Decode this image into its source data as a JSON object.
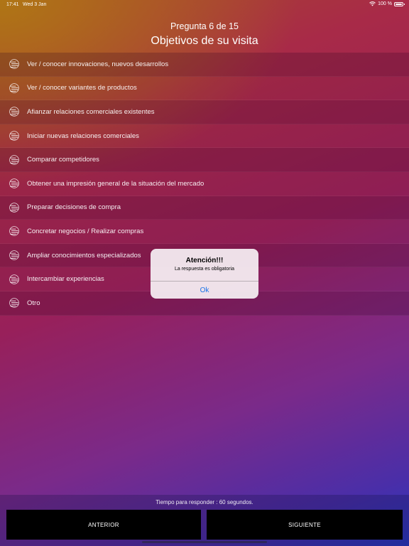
{
  "status_bar": {
    "time": "17:41",
    "date": "Wed 3 Jan",
    "battery": "100 %"
  },
  "header": {
    "counter": "Pregunta 6 de 15",
    "title": "Objetivos de su visita"
  },
  "options": [
    {
      "label": "Ver / conocer innovaciones, nuevos desarrollos"
    },
    {
      "label": "Ver / conocer variantes de productos"
    },
    {
      "label": "Afianzar relaciones comerciales existentes"
    },
    {
      "label": "Iniciar nuevas relaciones comerciales"
    },
    {
      "label": "Comparar competidores"
    },
    {
      "label": "Obtener una impresión general de la situación del mercado"
    },
    {
      "label": "Preparar decisiones de compra"
    },
    {
      "label": "Concretar negocios / Realizar compras"
    },
    {
      "label": "Ampliar conocimientos especializados"
    },
    {
      "label": "Intercambiar experiencias"
    },
    {
      "label": "Otro"
    }
  ],
  "option_icon": "select-option-icon",
  "alert": {
    "title": "Atención!!!",
    "message": "La respuesta es obligatoria",
    "ok_label": "Ok"
  },
  "footer": {
    "timer_text": "Tiempo para responder : 60 segundos.",
    "prev_label": "ANTERIOR",
    "next_label": "SIGUIENTE"
  },
  "colors": {
    "accent": "#1a73e8",
    "button_bg": "#000000"
  }
}
